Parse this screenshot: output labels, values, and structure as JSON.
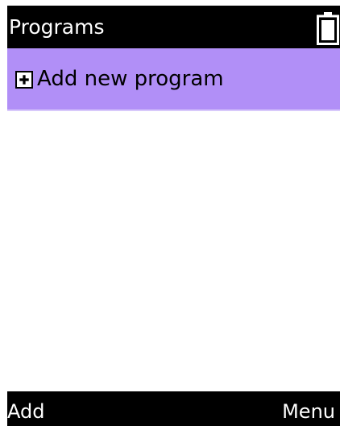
{
  "header": {
    "title": "Programs",
    "battery_icon": "battery-icon"
  },
  "list": {
    "items": [
      {
        "label": "Add new program",
        "icon": "plus-icon",
        "selected": true
      }
    ]
  },
  "softkeys": {
    "left_label": "Add",
    "right_label": "Menu"
  },
  "colors": {
    "bar": "#000000",
    "highlight": "#b18ff7",
    "background": "#ffffff",
    "text_on_bar": "#ffffff"
  }
}
